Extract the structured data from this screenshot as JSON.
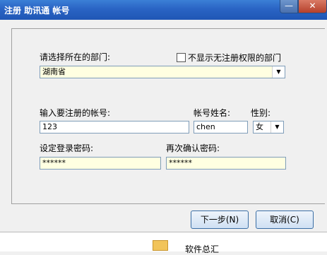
{
  "window": {
    "title": "注册 助讯通 帐号",
    "minimize": "—",
    "close": "✕"
  },
  "form": {
    "dept_label": "请选择所在的部门:",
    "hide_checkbox_label": "不显示无注册权限的部门",
    "dept_value": "湖南省",
    "account_label": "输入要注册的帐号:",
    "account_value": "123",
    "name_label": "帐号姓名:",
    "name_value": "chen",
    "gender_label": "性别:",
    "gender_value": "女",
    "password_label": "设定登录密码:",
    "password_value": "******",
    "confirm_label": "再次确认密码:",
    "confirm_value": "******"
  },
  "buttons": {
    "next": "下一步(N)",
    "cancel": "取消(C)"
  },
  "background": {
    "text": "软件总汇"
  }
}
